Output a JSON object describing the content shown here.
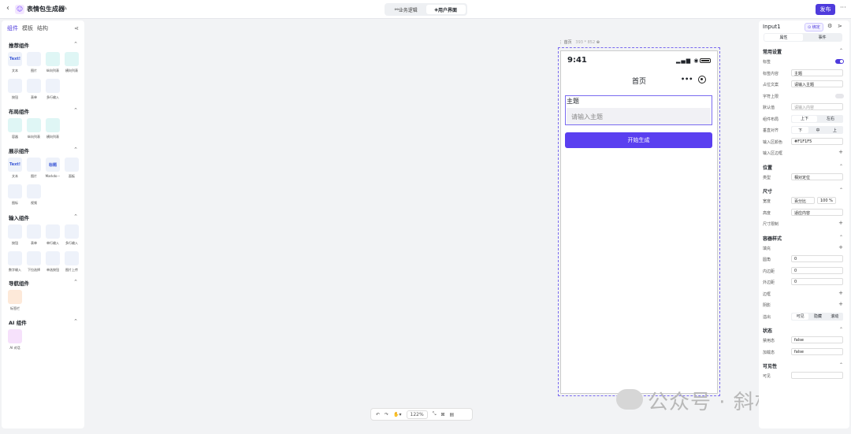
{
  "topbar": {
    "title": "表情包生成器",
    "tabs": [
      "业务逻辑",
      "用户界面"
    ],
    "publish": "发布",
    "more": "···"
  },
  "left": {
    "tabs": [
      "组件",
      "模板",
      "结构"
    ],
    "sections": [
      {
        "title": "推荐组件",
        "items": [
          "文本",
          "图片",
          "纵向列表",
          "横向列表",
          "按钮",
          "表单",
          "多行输入"
        ]
      },
      {
        "title": "布局组件",
        "items": [
          "容器",
          "纵向列表",
          "横向列表"
        ]
      },
      {
        "title": "展示组件",
        "items": [
          "文本",
          "图片",
          "Markdo···",
          "面板",
          "图标",
          "视频"
        ]
      },
      {
        "title": "输入组件",
        "items": [
          "按钮",
          "表单",
          "单行输入",
          "多行输入",
          "数字输入",
          "下拉选择",
          "单选按钮",
          "图片上传"
        ]
      },
      {
        "title": "导航组件",
        "items": [
          "标签栏"
        ]
      },
      {
        "title": "AI 组件",
        "items": [
          "AI 对话"
        ]
      }
    ],
    "tile_text": {
      "text": "Text!",
      "md": "标题"
    }
  },
  "canvas": {
    "frame_label": "首页",
    "frame_size": "393 * 852",
    "phone": {
      "time": "9:41",
      "signal": "▂▄▆ ◉",
      "page_title": "首页",
      "dots": "•••",
      "field_label": "主题",
      "placeholder": "请输入主题",
      "button": "开始生成"
    },
    "zoom": "122%"
  },
  "watermark": "公众号 · 斜杠君",
  "right": {
    "title": "Input1",
    "bind": "绑定",
    "ptabs": [
      "属性",
      "事件"
    ],
    "common": "常用设置",
    "rows": [
      {
        "label": "标签",
        "type": "switch-on"
      },
      {
        "label": "标签内容",
        "value": "主题"
      },
      {
        "label": "占位文案",
        "value": "请输入主题"
      },
      {
        "label": "字符上限",
        "type": "switch-off"
      },
      {
        "label": "默认值",
        "value": "请输入内容",
        "ph": true
      },
      {
        "label": "组件布局",
        "seg": [
          "上下",
          "左右"
        ]
      },
      {
        "label": "垂直对齐",
        "seg": [
          "下",
          "中",
          "上"
        ]
      },
      {
        "label": "输入区颜色",
        "value": "#F1F1F5"
      },
      {
        "label": "输入区边框",
        "type": "plus"
      }
    ],
    "position": "位置",
    "position_rows": [
      {
        "label": "类型",
        "value": "相对定位"
      }
    ],
    "size": "尺寸",
    "size_rows": [
      {
        "label": "宽度",
        "value": "百分比",
        "extra": "100",
        "unit": "%"
      },
      {
        "label": "高度",
        "value": "适应内容"
      },
      {
        "label": "尺寸限制",
        "type": "plus"
      }
    ],
    "container": "容器样式",
    "container_rows": [
      {
        "label": "填充",
        "type": "plus"
      },
      {
        "label": "圆角",
        "value": "0"
      },
      {
        "label": "内边距",
        "value": "0"
      },
      {
        "label": "外边距",
        "value": "0"
      },
      {
        "label": "边框",
        "type": "plus"
      },
      {
        "label": "阴影",
        "type": "plus"
      },
      {
        "label": "溢出",
        "seg": [
          "可见",
          "隐藏",
          "滚动"
        ]
      }
    ],
    "state": "状态",
    "state_rows": [
      {
        "label": "禁用态",
        "value": "false"
      },
      {
        "label": "加载态",
        "value": "false"
      }
    ],
    "visibility": "可见性",
    "vis_rows": [
      {
        "label": "可见",
        "value": ""
      }
    ]
  }
}
